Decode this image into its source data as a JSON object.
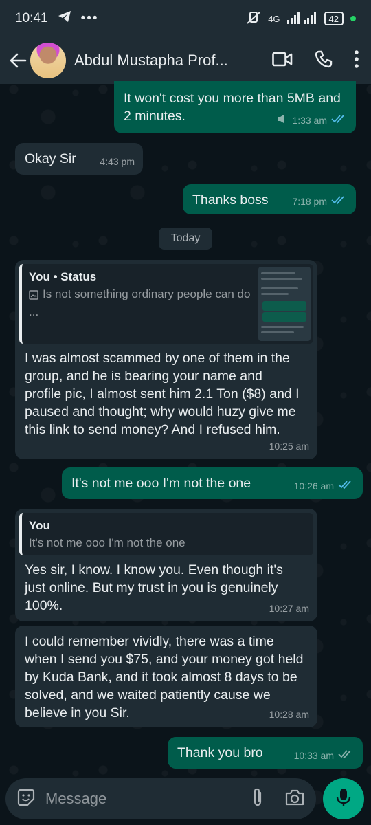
{
  "status_bar": {
    "time": "10:41",
    "network": "4G",
    "battery": "42"
  },
  "header": {
    "contact_name": "Abdul Mustapha Prof..."
  },
  "messages": {
    "m1": {
      "text": "It won't cost you more than 5MB and 2 minutes.",
      "time": "1:33 am"
    },
    "m2": {
      "text": "Okay Sir",
      "time": "4:43 pm"
    },
    "m3": {
      "text": "Thanks boss",
      "time": "7:18 pm"
    },
    "day": "Today",
    "m4": {
      "quote_title": "You • Status",
      "quote_text": "Is not something ordinary people can do",
      "quote_more": "...",
      "text": "I was almost scammed by one of them in the group, and he is bearing your name and profile pic, I almost sent him 2.1 Ton ($8) and I paused and thought; why would huzy give me this link to send money? And I refused him.",
      "time": "10:25 am"
    },
    "m5": {
      "text": "It's not me ooo I'm not the one",
      "time": "10:26 am"
    },
    "m6": {
      "quote_title": "You",
      "quote_text": "It's not me ooo I'm not the one",
      "text": "Yes sir, I know. I know you. Even though it's just online. But my trust in you is genuinely 100%.",
      "time": "10:27 am"
    },
    "m7": {
      "text": "I could remember vividly, there was a time when I send you $75, and your money got held by Kuda Bank, and it took almost 8 days to be solved, and we waited patiently cause we believe in you Sir.",
      "time": "10:28 am"
    },
    "m8": {
      "text": "Thank you bro",
      "time": "10:33 am"
    }
  },
  "input": {
    "placeholder": "Message"
  },
  "colors": {
    "incoming": "#1f2c34",
    "outgoing": "#005c4b",
    "accent": "#00a884",
    "read_ticks": "#53bdeb"
  },
  "icons": [
    "telegram-icon",
    "back-arrow-icon",
    "video-call-icon",
    "phone-icon",
    "more-icon",
    "emoji-sticker-icon",
    "attach-icon",
    "camera-icon",
    "mic-icon",
    "double-check-icon"
  ]
}
